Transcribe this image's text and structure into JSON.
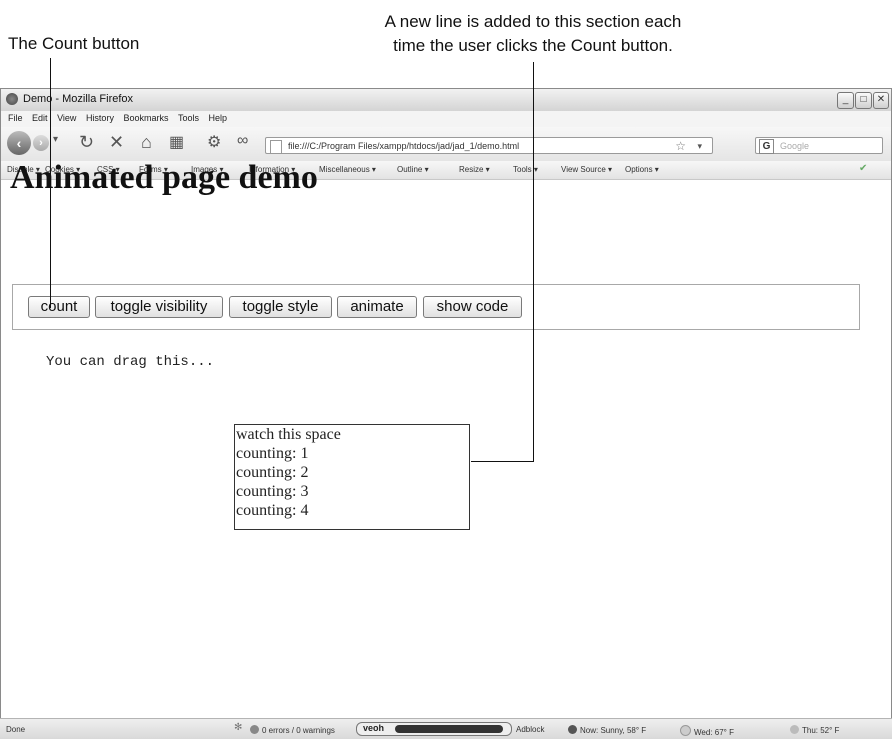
{
  "callouts": {
    "count_button": "The Count button",
    "new_line_1": "A new line is added to this section each",
    "new_line_2": "time the user clicks the Count button."
  },
  "window": {
    "title": "Demo - Mozilla Firefox",
    "controls": [
      "_",
      "□",
      "✕"
    ]
  },
  "menu": [
    "File",
    "Edit",
    "View",
    "History",
    "Bookmarks",
    "Tools",
    "Help"
  ],
  "navigation": {
    "url": "file:///C:/Program Files/xampp/htdocs/jad/jad_1/demo.html",
    "search_placeholder": "Google",
    "search_engine_letter": "G"
  },
  "dev_toolbar": [
    "Disable ▾",
    "Cookies ▾",
    "CSS ▾",
    "Forms ▾",
    "Images ▾",
    "Information ▾",
    "Miscellaneous ▾",
    "Outline ▾",
    "Resize ▾",
    "Tools ▾",
    "View Source ▾",
    "Options ▾"
  ],
  "page": {
    "title": "Animated page demo",
    "buttons": [
      "count",
      "toggle visibility",
      "toggle style",
      "animate",
      "show code"
    ],
    "drag_text": "You can drag this...",
    "watch_box": [
      "watch this space",
      "counting: 1",
      "counting: 2",
      "counting: 3",
      "counting: 4"
    ]
  },
  "status": {
    "done": "Done",
    "errors": "0 errors / 0 warnings",
    "veoh": "veoh",
    "adblock": "Adblock",
    "now": "Now: Sunny, 58° F",
    "wed": "Wed: 67° F",
    "thu": "Thu: 52° F"
  }
}
